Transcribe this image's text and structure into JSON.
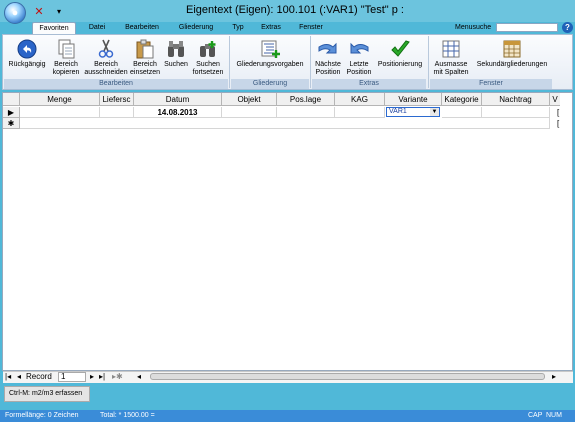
{
  "window": {
    "title": "Eigentext (Eigen): 100.101   (:VAR1) \"Test\" p  :"
  },
  "qat": {
    "close_symbol": "✕",
    "arrow_symbol": "▾"
  },
  "menu": {
    "tabs": [
      "Favoriten",
      "Datei",
      "Bearbeiten",
      "Gliederung",
      "Typ",
      "Extras",
      "Fenster"
    ],
    "search_label": "Menusuche",
    "help_symbol": "?"
  },
  "ribbon": {
    "groups": [
      {
        "label": "Bearbeiten"
      },
      {
        "label": "Gliederung"
      },
      {
        "label": "Extras"
      },
      {
        "label": "Fenster"
      }
    ],
    "buttons": [
      {
        "line1": "Rückgängig",
        "line2": "",
        "icon": "undo-icon"
      },
      {
        "line1": "Bereich",
        "line2": "kopieren",
        "icon": "copy-icon"
      },
      {
        "line1": "Bereich",
        "line2": "ausschneiden",
        "icon": "scissors-icon"
      },
      {
        "line1": "Bereich",
        "line2": "einsetzen",
        "icon": "paste-icon"
      },
      {
        "line1": "Suchen",
        "line2": "",
        "icon": "binoculars-icon"
      },
      {
        "line1": "Suchen",
        "line2": "fortsetzen",
        "icon": "binoculars-plus-icon"
      },
      {
        "line1": "Gliederungsvorgaben",
        "line2": "",
        "icon": "outline-list-icon"
      },
      {
        "line1": "Nächste",
        "line2": "Position",
        "icon": "arrow-next-icon"
      },
      {
        "line1": "Letzte",
        "line2": "Position",
        "icon": "arrow-last-icon"
      },
      {
        "line1": "Positionierung",
        "line2": "",
        "icon": "checkmark-icon"
      },
      {
        "line1": "Ausmasse",
        "line2": "mit Spalten",
        "icon": "columns-icon"
      },
      {
        "line1": "Sekundärgliederungen",
        "line2": "",
        "icon": "calendar-grid-icon"
      }
    ]
  },
  "grid": {
    "columns": [
      "Menge",
      "Liefersc",
      "Datum",
      "Objekt",
      "Pos.lage",
      "KAG",
      "Variante",
      "Kategorie",
      "Nachtrag",
      "V"
    ],
    "row1": {
      "selector": "▶",
      "datum": "14.08.2013",
      "variante": "VAR1",
      "last": "["
    },
    "row2": {
      "selector": "✱",
      "last": "["
    }
  },
  "nav": {
    "first": "|◂",
    "prev": "◂",
    "label": "Record",
    "record": "1",
    "next": "▸",
    "next_end": "▸|",
    "new": "▸✱",
    "scroll_left": "◂",
    "scroll_right": "▸"
  },
  "hint": {
    "text": "Ctrl-M: m2/m3 erfassen"
  },
  "status": {
    "formel": "Formellänge: 0 Zeichen",
    "total": "Total:  * 1500.00 =",
    "cap": "CAP",
    "num": "NUM"
  }
}
